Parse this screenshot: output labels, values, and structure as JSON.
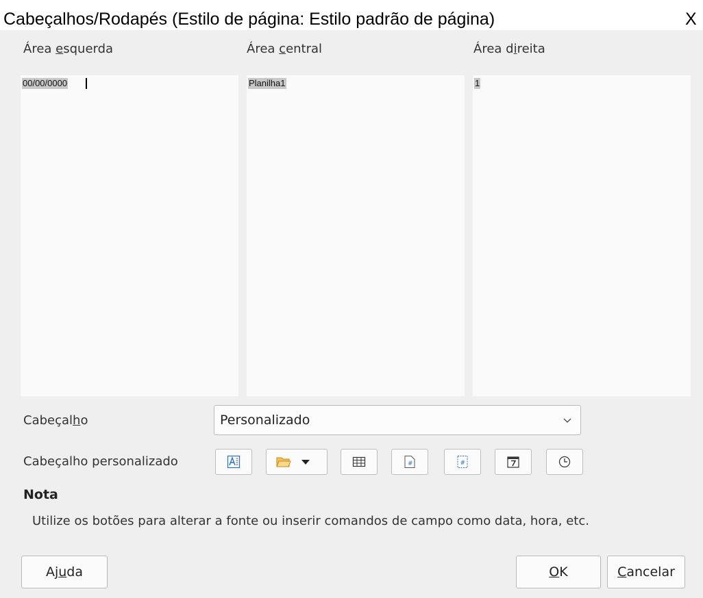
{
  "window": {
    "title": "Cabeçalhos/Rodapés (Estilo de página: Estilo padrão de página)",
    "close_label": "X"
  },
  "areas": [
    {
      "label_pre": "Área ",
      "label_mnemonic": "e",
      "label_post": "squerda",
      "content": "00/00/0000"
    },
    {
      "label_pre": "Área ",
      "label_mnemonic": "c",
      "label_post": "entral",
      "content": "Planilha1"
    },
    {
      "label_pre": "Área d",
      "label_mnemonic": "i",
      "label_post": "reita",
      "content": "1"
    }
  ],
  "header_row": {
    "label_pre": "Cabeçal",
    "label_mnemonic": "h",
    "label_post": "o",
    "selected": "Personalizado"
  },
  "custom_row": {
    "label": "Cabeçalho personalizado",
    "buttons": [
      "text-attributes-icon",
      "title-folder-icon",
      "sheet-name-icon",
      "page-number-icon",
      "page-count-icon",
      "date-icon",
      "time-icon"
    ]
  },
  "note": {
    "title": "Nota",
    "text": "Utilize os botões para alterar a fonte ou inserir comandos de campo como data, hora, etc."
  },
  "footer": {
    "help": {
      "pre": "Aj",
      "mnemonic": "u",
      "post": "da"
    },
    "ok": {
      "pre": "",
      "mnemonic": "O",
      "post": "K"
    },
    "cancel": {
      "pre": "",
      "mnemonic": "C",
      "post": "ancelar"
    }
  }
}
